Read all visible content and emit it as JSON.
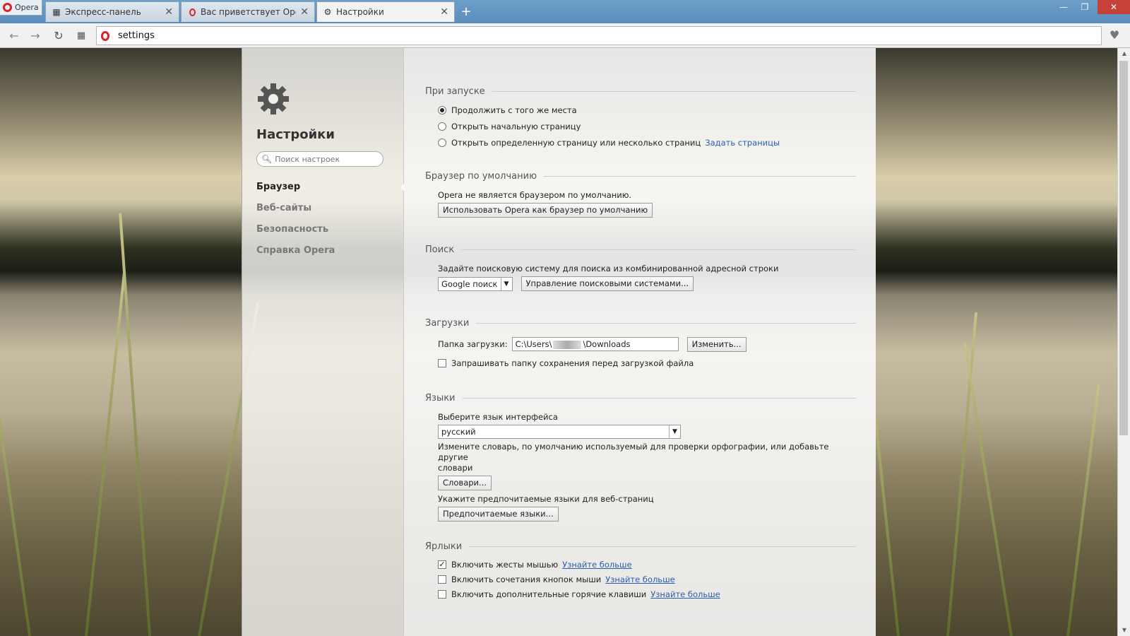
{
  "browser": {
    "menu_label": "Opera",
    "tabs": [
      {
        "title": "Экспресс-панель",
        "icon": "grid-icon"
      },
      {
        "title": "Вас приветствует Opera!",
        "icon": "opera-icon"
      },
      {
        "title": "Настройки",
        "icon": "gear-icon"
      }
    ],
    "address": "settings"
  },
  "sidebar": {
    "title": "Настройки",
    "search_placeholder": "Поиск настроек",
    "items": [
      {
        "label": "Браузер",
        "active": true
      },
      {
        "label": "Веб-сайты"
      },
      {
        "label": "Безопасность"
      },
      {
        "label": "Справка Opera"
      }
    ]
  },
  "startup": {
    "heading": "При запуске",
    "opt1": "Продолжить с того же места",
    "opt2": "Открыть начальную страницу",
    "opt3": "Открыть определенную страницу или несколько страниц",
    "opt3_link": "Задать страницы"
  },
  "default_browser": {
    "heading": "Браузер по умолчанию",
    "text": "Opera не является браузером по умолчанию.",
    "button": "Использовать Opera как браузер по умолчанию"
  },
  "search": {
    "heading": "Поиск",
    "text": "Задайте поисковую систему для поиска из комбинированной адресной строки",
    "engine": "Google поиск",
    "manage_button": "Управление поисковыми системами..."
  },
  "downloads": {
    "heading": "Загрузки",
    "folder_label": "Папка загрузки:",
    "folder_prefix": "C:\\Users\\",
    "folder_suffix": "\\Downloads",
    "change_button": "Изменить...",
    "ask_label": "Запрашивать папку сохранения перед загрузкой файла"
  },
  "languages": {
    "heading": "Языки",
    "ui_label": "Выберите язык интерфейса",
    "ui_value": "русский",
    "dict_text": "Измените словарь, по умолчанию используемый для проверки орфографии, или добавьте другие",
    "dict_text2": "словари",
    "dict_button": "Словари...",
    "pref_text": "Укажите предпочитаемые языки для веб-страниц",
    "pref_button": "Предпочитаемые языки..."
  },
  "shortcuts": {
    "heading": "Ярлыки",
    "opt1": "Включить жесты мышью",
    "opt2": "Включить сочетания кнопок мыши",
    "opt3": "Включить дополнительные горячие клавиши",
    "learn_more": "Узнайте больше"
  }
}
